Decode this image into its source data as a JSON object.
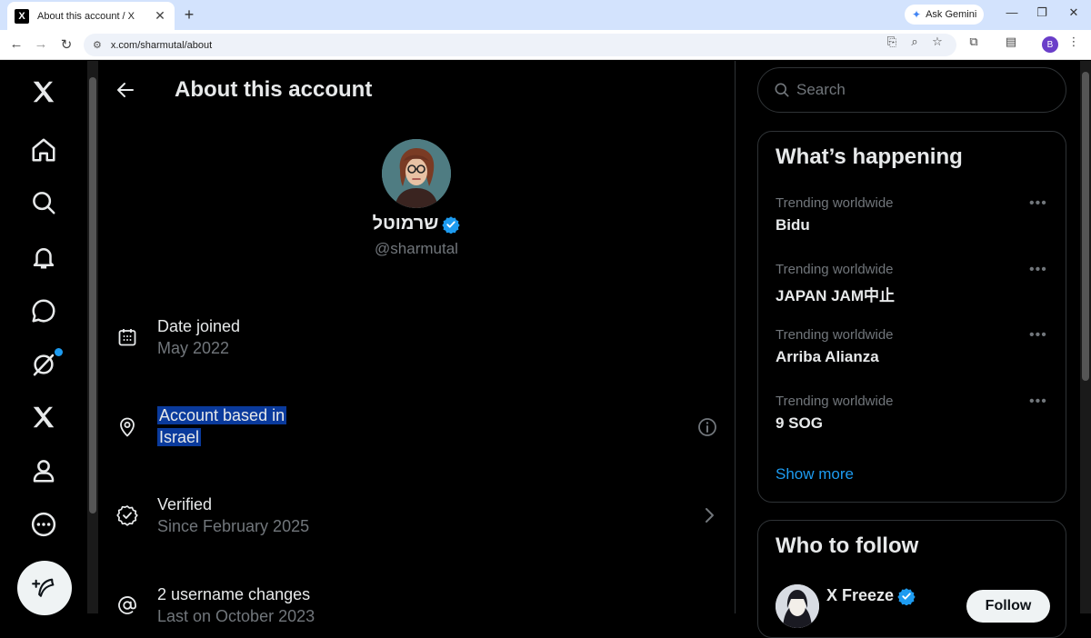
{
  "browser": {
    "tab_title": "About this account / X",
    "tab_favicon": "X",
    "url": "x.com/sharmutal/about",
    "gemini_label": "Ask Gemini",
    "profile_initial": "B"
  },
  "nav": {
    "items": [
      "x-logo",
      "home",
      "explore",
      "notifications",
      "messages",
      "grok",
      "premium",
      "profile",
      "more"
    ],
    "notification_dot_color": "#1d9bf0"
  },
  "main": {
    "title": "About this account",
    "display_name": "שרמוטל",
    "handle": "@sharmutal",
    "rows": [
      {
        "title": "Date joined",
        "sub": "May 2022",
        "icon": "calendar-icon"
      },
      {
        "title_line1": "Account based in",
        "title_line2": "Israel",
        "icon": "location-pin-icon"
      },
      {
        "title": "Verified",
        "sub": "Since February 2025",
        "icon": "verified-badge-icon"
      },
      {
        "title": "2 username changes",
        "sub": "Last on October 2023",
        "icon": "at-sign-icon"
      }
    ]
  },
  "right": {
    "search_placeholder": "Search",
    "whats_happening": "What’s happening",
    "trends": [
      {
        "meta": "Trending worldwide",
        "name": "Bidu"
      },
      {
        "meta": "Trending worldwide",
        "name": "JAPAN JAM中止"
      },
      {
        "meta": "Trending worldwide",
        "name": "Arriba Alianza"
      },
      {
        "meta": "Trending worldwide",
        "name": "9 SOG"
      }
    ],
    "show_more": "Show more",
    "who_to_follow": "Who to follow",
    "follow_suggestion": {
      "name": "X Freeze",
      "button": "Follow"
    }
  },
  "colors": {
    "accent": "#1d9bf0",
    "selection": "#0a3a9c",
    "text": "#e7e9ea",
    "muted": "#71767b"
  }
}
